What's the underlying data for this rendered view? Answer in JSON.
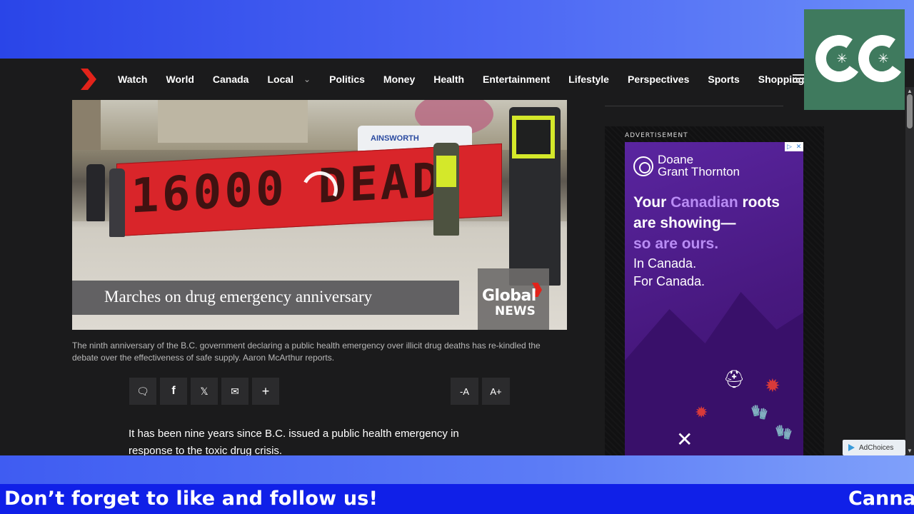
{
  "nav": {
    "items": [
      "Watch",
      "World",
      "Canada",
      "Local",
      "Politics",
      "Money",
      "Health",
      "Entertainment",
      "Lifestyle",
      "Perspectives",
      "Sports",
      "Shopping"
    ]
  },
  "video": {
    "title": "Marches on drug emergency anniversary",
    "banner_text": "16000 DEAD",
    "brand_line1": "Global",
    "brand_line2": "NEWS",
    "van_text": "AINSWORTH"
  },
  "caption": "The ninth anniversary of the B.C. government declaring a public health emergency over illicit drug deaths has re-kindled the debate over the effectiveness of safe supply. Aaron McArthur reports.",
  "share": {
    "icons": [
      "comment-icon",
      "facebook-icon",
      "x-icon",
      "email-icon",
      "plus-icon"
    ],
    "glyphs": [
      "🗨",
      "f",
      "𝕏",
      "✉",
      "+"
    ],
    "font_decrease": "-A",
    "font_increase": "A+"
  },
  "article": {
    "paragraph": "It has been nine years since B.C. issued a public health emergency in response to the toxic drug crisis."
  },
  "ad": {
    "label": "ADVERTISEMENT",
    "brand_line1": "Doane",
    "brand_line2": "Grant Thornton",
    "headline_part1": "Your ",
    "headline_accent1": "Canadian",
    "headline_part2": " roots are showing—",
    "headline_accent2": "so are ours.",
    "sub_line1": "In Canada.",
    "sub_line2": "For Canada.",
    "adchoices": "AdChoices"
  },
  "ticker": {
    "message": "Don’t forget to like and follow us!",
    "message_next": "Cannal"
  },
  "colors": {
    "ticker_bg": "#1020e8",
    "logo_bg": "#3f7a5e",
    "ad_purple": "#4a1d86",
    "ad_accent": "#b98cf5",
    "brand_red": "#e2231a"
  }
}
